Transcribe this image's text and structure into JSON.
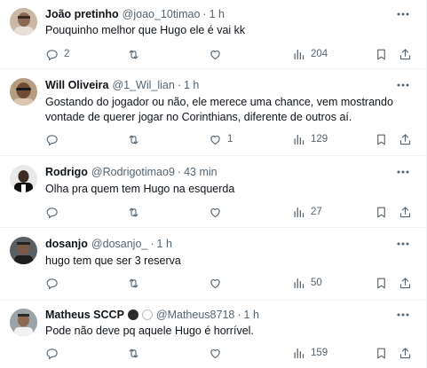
{
  "tweets": [
    {
      "name": "João pretinho",
      "handle": "@joao_10timao",
      "time": "1 h",
      "text": "Pouquinho melhor que Hugo ele é vai kk",
      "replies": "2",
      "retweets": "",
      "likes": "",
      "views": "204"
    },
    {
      "name": "Will Oliveira",
      "handle": "@1_Wil_lian",
      "time": "1 h",
      "text": "Gostando do jogador ou não, ele merece uma chance, vem mostrando vontade de querer jogar no Corinthians, diferente de outros aí.",
      "replies": "",
      "retweets": "",
      "likes": "1",
      "views": "129"
    },
    {
      "name": "Rodrigo",
      "handle": "@Rodrigotimao9",
      "time": "43 min",
      "text": "Olha pra quem tem Hugo na esquerda",
      "replies": "",
      "retweets": "",
      "likes": "",
      "views": "27"
    },
    {
      "name": "dosanjo",
      "handle": "@dosanjo_",
      "time": "1 h",
      "text": "hugo tem que ser 3 reserva",
      "replies": "",
      "retweets": "",
      "likes": "",
      "views": "50"
    },
    {
      "name": "Matheus SCCP",
      "handle": "@Matheus8718",
      "time": "1 h",
      "text": "Pode não deve pq aquele Hugo é  horrível.",
      "replies": "",
      "retweets": "",
      "likes": "",
      "views": "159"
    }
  ],
  "separator": "·",
  "icons": {
    "reply": "reply-icon",
    "retweet": "retweet-icon",
    "like": "heart-icon",
    "views": "views-icon",
    "bookmark": "bookmark-icon",
    "share": "share-icon",
    "more": "more-icon"
  },
  "colors": {
    "text": "#0f1419",
    "secondary": "#536471",
    "border": "#eff3f4"
  }
}
